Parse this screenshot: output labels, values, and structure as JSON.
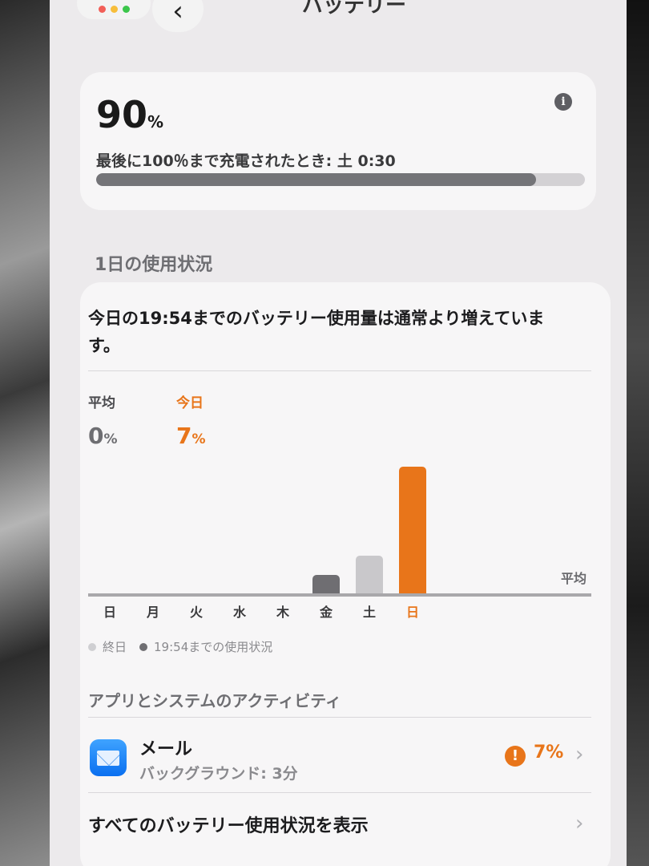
{
  "nav": {
    "title": "バッテリー",
    "back_icon": "chevron-left-icon"
  },
  "level": {
    "value": "90",
    "unit": "%",
    "fraction": 0.9,
    "last_full_charge": "最後に100％まで充電されたとき: 土 0:30"
  },
  "usage": {
    "section_title": "1日の使用状況",
    "notice": "今日の19:54までのバッテリー使用量は通常より増えています。",
    "average_label": "平均",
    "average_value": "0",
    "average_unit": "%",
    "today_label": "今日",
    "today_value": "7",
    "today_unit": "%",
    "avg_line_label": "平均",
    "legend_full_day": "終日",
    "legend_until": "19:54までの使用状況"
  },
  "colors": {
    "accent_orange": "#e8751a",
    "bar_gray_dark": "#6f6e72",
    "bar_gray_light": "#c9c8cb"
  },
  "chart_data": {
    "type": "bar",
    "categories": [
      "日",
      "月",
      "火",
      "水",
      "木",
      "金",
      "土",
      "日"
    ],
    "values": [
      0,
      0,
      0,
      0,
      0,
      1.0,
      2.1,
      7.0
    ],
    "highlight_index": 7,
    "ylim": [
      0,
      8
    ]
  },
  "activity": {
    "title": "アプリとシステムのアクティビティ",
    "apps": [
      {
        "name": "メール",
        "detail": "バックグラウンド: 3分",
        "percent": "7%",
        "icon": "mail-icon"
      }
    ],
    "show_all": "すべてのバッテリー使用状況を表示"
  }
}
